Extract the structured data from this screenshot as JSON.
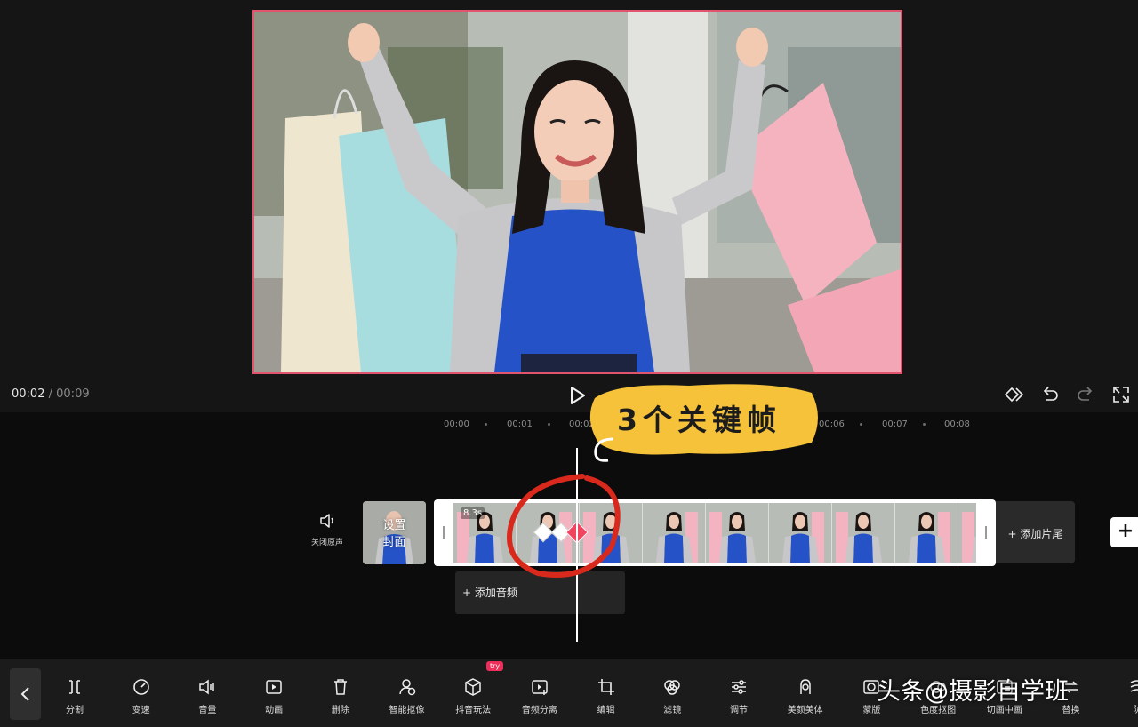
{
  "player": {
    "current_time": "00:02",
    "separator": "/",
    "total_time": "00:09"
  },
  "ruler": {
    "ticks": [
      "00:00",
      "00:01",
      "00:02",
      "00:06",
      "00:07",
      "00:08"
    ]
  },
  "timeline": {
    "mute_label": "关闭原声",
    "cover_label_line1": "设置",
    "cover_label_line2": "封面",
    "clip_duration": "8.3s",
    "add_tail_label": "添加片尾",
    "add_audio_label": "添加音频",
    "add_track_symbol": "+"
  },
  "annotation": {
    "text": "3个关键帧"
  },
  "toolbar": {
    "items": [
      {
        "label": "分割",
        "icon": "split-icon"
      },
      {
        "label": "变速",
        "icon": "speed-icon"
      },
      {
        "label": "音量",
        "icon": "volume-icon"
      },
      {
        "label": "动画",
        "icon": "animation-icon"
      },
      {
        "label": "删除",
        "icon": "delete-icon"
      },
      {
        "label": "智能抠像",
        "icon": "smart-cutout-icon"
      },
      {
        "label": "抖音玩法",
        "icon": "cube-icon"
      },
      {
        "label": "音频分离",
        "icon": "audio-separate-icon"
      },
      {
        "label": "编辑",
        "icon": "crop-icon"
      },
      {
        "label": "滤镜",
        "icon": "filter-icon"
      },
      {
        "label": "调节",
        "icon": "adjust-icon"
      },
      {
        "label": "美颜美体",
        "icon": "beauty-icon"
      },
      {
        "label": "蒙版",
        "icon": "mask-icon"
      },
      {
        "label": "色度抠图",
        "icon": "chroma-key-icon"
      },
      {
        "label": "切画中画",
        "icon": "pip-icon"
      },
      {
        "label": "替换",
        "icon": "replace-icon"
      },
      {
        "label": "防",
        "icon": "stabilize-icon"
      }
    ],
    "try_badge": "try"
  },
  "watermark": "头条@摄影自学班",
  "colors": {
    "accent_red": "#e0546e",
    "keyframe_red": "#f0445f",
    "annotation_yellow": "#f5c23a",
    "annotation_circle": "#d8291c"
  }
}
